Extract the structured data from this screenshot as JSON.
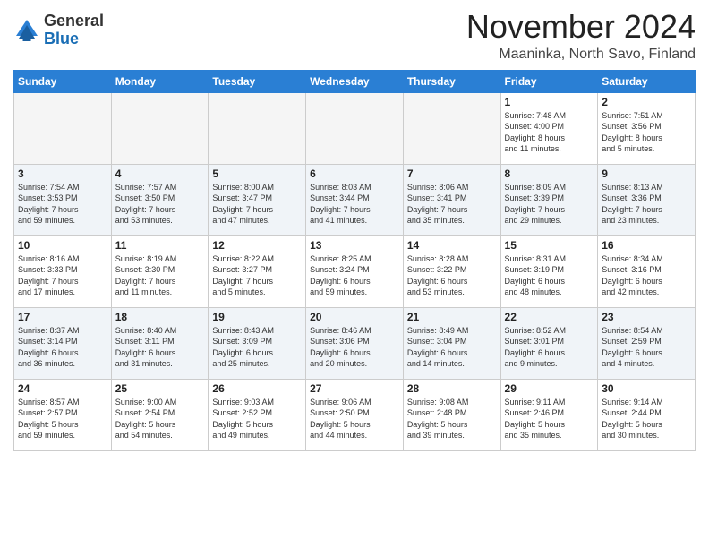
{
  "header": {
    "logo_general": "General",
    "logo_blue": "Blue",
    "month_title": "November 2024",
    "location": "Maaninka, North Savo, Finland"
  },
  "weekdays": [
    "Sunday",
    "Monday",
    "Tuesday",
    "Wednesday",
    "Thursday",
    "Friday",
    "Saturday"
  ],
  "weeks": [
    [
      {
        "day": "",
        "info": ""
      },
      {
        "day": "",
        "info": ""
      },
      {
        "day": "",
        "info": ""
      },
      {
        "day": "",
        "info": ""
      },
      {
        "day": "",
        "info": ""
      },
      {
        "day": "1",
        "info": "Sunrise: 7:48 AM\nSunset: 4:00 PM\nDaylight: 8 hours\nand 11 minutes."
      },
      {
        "day": "2",
        "info": "Sunrise: 7:51 AM\nSunset: 3:56 PM\nDaylight: 8 hours\nand 5 minutes."
      }
    ],
    [
      {
        "day": "3",
        "info": "Sunrise: 7:54 AM\nSunset: 3:53 PM\nDaylight: 7 hours\nand 59 minutes."
      },
      {
        "day": "4",
        "info": "Sunrise: 7:57 AM\nSunset: 3:50 PM\nDaylight: 7 hours\nand 53 minutes."
      },
      {
        "day": "5",
        "info": "Sunrise: 8:00 AM\nSunset: 3:47 PM\nDaylight: 7 hours\nand 47 minutes."
      },
      {
        "day": "6",
        "info": "Sunrise: 8:03 AM\nSunset: 3:44 PM\nDaylight: 7 hours\nand 41 minutes."
      },
      {
        "day": "7",
        "info": "Sunrise: 8:06 AM\nSunset: 3:41 PM\nDaylight: 7 hours\nand 35 minutes."
      },
      {
        "day": "8",
        "info": "Sunrise: 8:09 AM\nSunset: 3:39 PM\nDaylight: 7 hours\nand 29 minutes."
      },
      {
        "day": "9",
        "info": "Sunrise: 8:13 AM\nSunset: 3:36 PM\nDaylight: 7 hours\nand 23 minutes."
      }
    ],
    [
      {
        "day": "10",
        "info": "Sunrise: 8:16 AM\nSunset: 3:33 PM\nDaylight: 7 hours\nand 17 minutes."
      },
      {
        "day": "11",
        "info": "Sunrise: 8:19 AM\nSunset: 3:30 PM\nDaylight: 7 hours\nand 11 minutes."
      },
      {
        "day": "12",
        "info": "Sunrise: 8:22 AM\nSunset: 3:27 PM\nDaylight: 7 hours\nand 5 minutes."
      },
      {
        "day": "13",
        "info": "Sunrise: 8:25 AM\nSunset: 3:24 PM\nDaylight: 6 hours\nand 59 minutes."
      },
      {
        "day": "14",
        "info": "Sunrise: 8:28 AM\nSunset: 3:22 PM\nDaylight: 6 hours\nand 53 minutes."
      },
      {
        "day": "15",
        "info": "Sunrise: 8:31 AM\nSunset: 3:19 PM\nDaylight: 6 hours\nand 48 minutes."
      },
      {
        "day": "16",
        "info": "Sunrise: 8:34 AM\nSunset: 3:16 PM\nDaylight: 6 hours\nand 42 minutes."
      }
    ],
    [
      {
        "day": "17",
        "info": "Sunrise: 8:37 AM\nSunset: 3:14 PM\nDaylight: 6 hours\nand 36 minutes."
      },
      {
        "day": "18",
        "info": "Sunrise: 8:40 AM\nSunset: 3:11 PM\nDaylight: 6 hours\nand 31 minutes."
      },
      {
        "day": "19",
        "info": "Sunrise: 8:43 AM\nSunset: 3:09 PM\nDaylight: 6 hours\nand 25 minutes."
      },
      {
        "day": "20",
        "info": "Sunrise: 8:46 AM\nSunset: 3:06 PM\nDaylight: 6 hours\nand 20 minutes."
      },
      {
        "day": "21",
        "info": "Sunrise: 8:49 AM\nSunset: 3:04 PM\nDaylight: 6 hours\nand 14 minutes."
      },
      {
        "day": "22",
        "info": "Sunrise: 8:52 AM\nSunset: 3:01 PM\nDaylight: 6 hours\nand 9 minutes."
      },
      {
        "day": "23",
        "info": "Sunrise: 8:54 AM\nSunset: 2:59 PM\nDaylight: 6 hours\nand 4 minutes."
      }
    ],
    [
      {
        "day": "24",
        "info": "Sunrise: 8:57 AM\nSunset: 2:57 PM\nDaylight: 5 hours\nand 59 minutes."
      },
      {
        "day": "25",
        "info": "Sunrise: 9:00 AM\nSunset: 2:54 PM\nDaylight: 5 hours\nand 54 minutes."
      },
      {
        "day": "26",
        "info": "Sunrise: 9:03 AM\nSunset: 2:52 PM\nDaylight: 5 hours\nand 49 minutes."
      },
      {
        "day": "27",
        "info": "Sunrise: 9:06 AM\nSunset: 2:50 PM\nDaylight: 5 hours\nand 44 minutes."
      },
      {
        "day": "28",
        "info": "Sunrise: 9:08 AM\nSunset: 2:48 PM\nDaylight: 5 hours\nand 39 minutes."
      },
      {
        "day": "29",
        "info": "Sunrise: 9:11 AM\nSunset: 2:46 PM\nDaylight: 5 hours\nand 35 minutes."
      },
      {
        "day": "30",
        "info": "Sunrise: 9:14 AM\nSunset: 2:44 PM\nDaylight: 5 hours\nand 30 minutes."
      }
    ]
  ]
}
